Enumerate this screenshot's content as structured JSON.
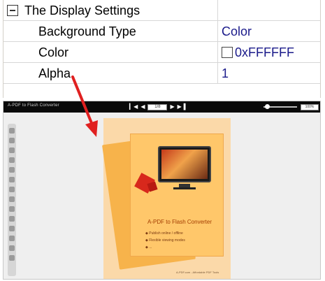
{
  "property_grid": {
    "category": {
      "label": "The Display Settings"
    },
    "rows": [
      {
        "name": "Background Type",
        "value": "Color"
      },
      {
        "name": "Color",
        "value": "0xFFFFFF",
        "swatch": "#FFFFFF"
      },
      {
        "name": "Alpha",
        "value": "1"
      }
    ]
  },
  "preview": {
    "app_title": "A-PDF to Flash Converter",
    "page_field": "1/8",
    "zoom_field": "100%",
    "book": {
      "title": "A-PDF to Flash Converter",
      "bullets": [
        "Publish online / offline",
        "Flexible viewing modes",
        "..."
      ],
      "footer": "A-PDF.com - Affordable PDF Tools"
    }
  },
  "colors": {
    "grid_value_text": "#1A1A8A",
    "arrow": "#E02020",
    "page_background": "#FBD9A9",
    "toolbar": "#0A0A0A"
  },
  "icons": [
    "collapse-icon",
    "color-swatch-icon",
    "first-page-icon",
    "prev-page-icon",
    "next-page-icon",
    "last-page-icon",
    "zoom-slider-icon",
    "red-arrow-pointer-icon"
  ]
}
